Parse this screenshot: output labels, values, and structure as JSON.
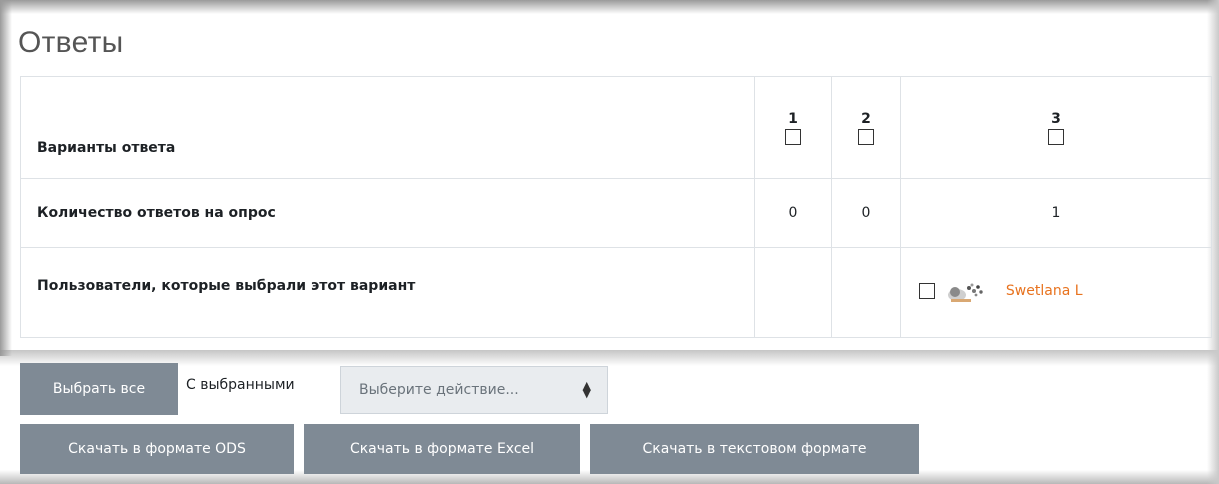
{
  "title": "Ответы",
  "table": {
    "rows": {
      "options_label": "Варианты ответа",
      "count_label": "Количество ответов на опрос",
      "users_label": "Пользователи, которые выбрали этот вариант"
    },
    "columns": [
      {
        "number": "1",
        "count": "0"
      },
      {
        "number": "2",
        "count": "0"
      },
      {
        "number": "3",
        "count": "1"
      }
    ],
    "users_in_column_3": [
      {
        "name": "Swetlana L",
        "avatar": "user-avatar-image"
      }
    ]
  },
  "actions": {
    "select_all": "Выбрать все",
    "with_selected": "С выбранными",
    "action_select_placeholder": "Выберите действие...",
    "download_ods": "Скачать в формате ODS",
    "download_excel": "Скачать в формате Excel",
    "download_text": "Скачать в текстовом формате"
  },
  "colors": {
    "button_bg": "#7f8a95",
    "link": "#e8731f",
    "border": "#dee2e6"
  }
}
